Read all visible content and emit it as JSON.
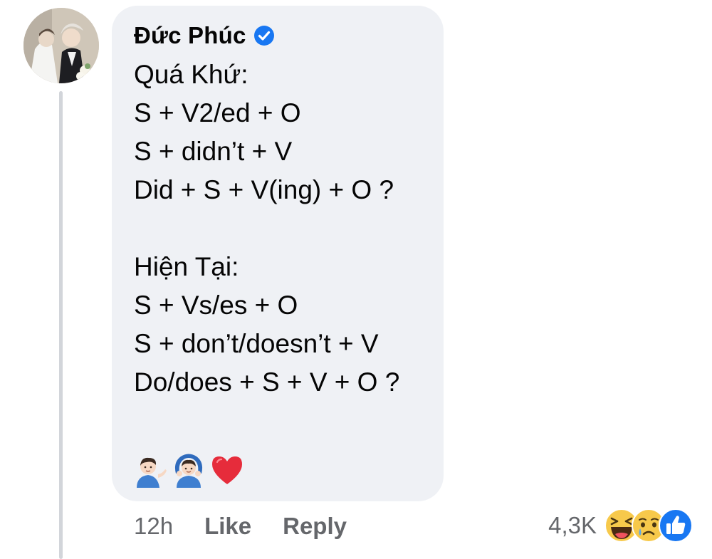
{
  "comment": {
    "author": "Đức Phúc",
    "lines": [
      "Quá Khứ:",
      "S + V2/ed + O",
      "S + didn’t + V",
      "Did + S + V(ing) + O ?",
      "",
      "Hiện Tại:",
      "S + Vs/es + O",
      "S + don’t/doesn’t + V",
      "Do/does + S + V + O ?"
    ],
    "emojis": [
      "man-tipping-hand-emoji",
      "man-gesturing-ok-emoji",
      "red-heart-emoji"
    ]
  },
  "meta": {
    "timestamp": "12h",
    "like_label": "Like",
    "reply_label": "Reply"
  },
  "reactions": {
    "count": "4,3K",
    "icons": [
      "haha-icon",
      "sad-icon",
      "like-icon"
    ]
  },
  "colors": {
    "bubble_bg": "#eff1f5",
    "text": "#050505",
    "meta_text": "#65676b",
    "verified_blue": "#1877f2",
    "thread_line": "#d2d5da"
  }
}
